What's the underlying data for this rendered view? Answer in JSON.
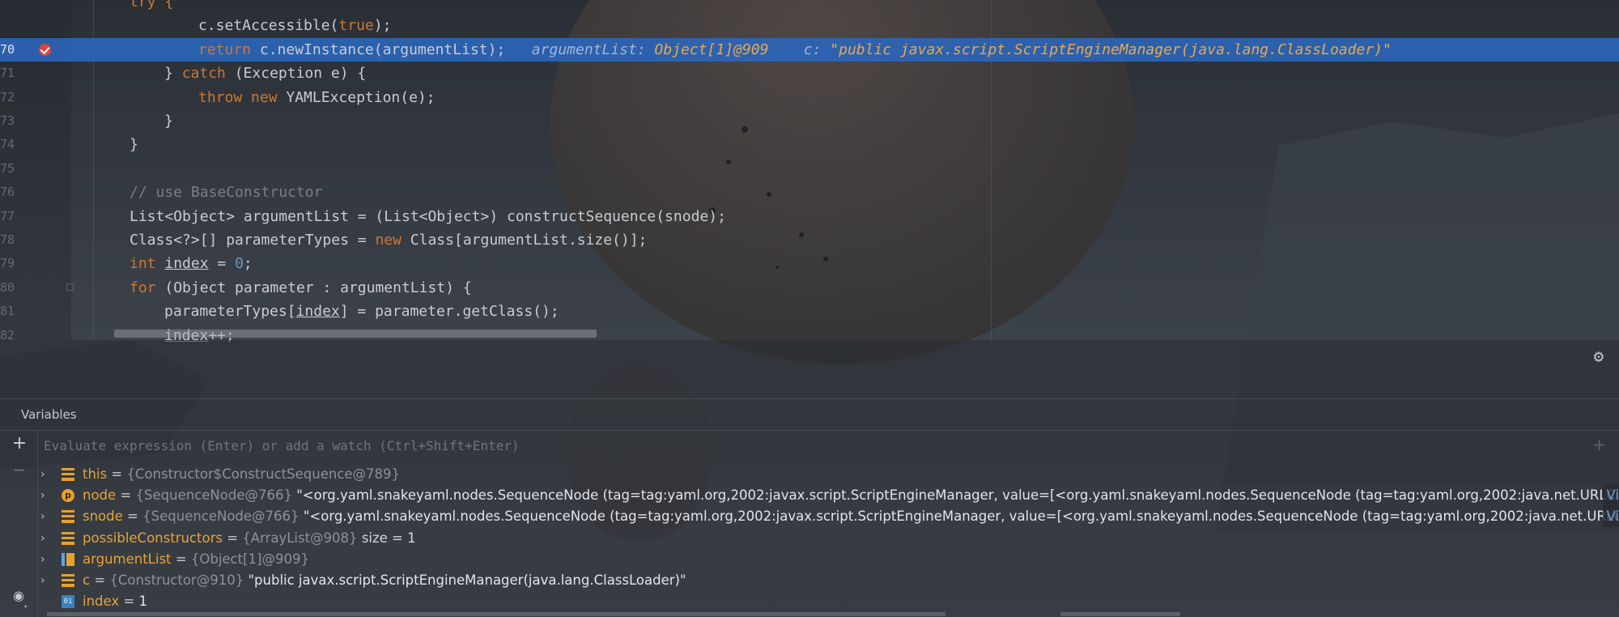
{
  "editor": {
    "lines": [
      {
        "num": "",
        "tokens": [
          {
            "t": "try {",
            "c": "kw"
          }
        ],
        "indent": 160
      },
      {
        "num": "",
        "tokens": [
          {
            "t": "c.setAccessible(",
            "c": ""
          },
          {
            "t": "true",
            "c": "kw"
          },
          {
            "t": ");",
            "c": ""
          }
        ],
        "indent": 245
      },
      {
        "num": "70",
        "tokens": [
          {
            "t": "return ",
            "c": "kw"
          },
          {
            "t": "c.newInstance(argumentList);",
            "c": ""
          }
        ],
        "indent": 245
      },
      {
        "num": "71",
        "tokens": [
          {
            "t": "} ",
            "c": ""
          },
          {
            "t": "catch ",
            "c": "kw"
          },
          {
            "t": "(Exception e) {",
            "c": ""
          }
        ],
        "indent": 203
      },
      {
        "num": "72",
        "tokens": [
          {
            "t": "throw new ",
            "c": "kw"
          },
          {
            "t": "YAMLException(e);",
            "c": ""
          }
        ],
        "indent": 245
      },
      {
        "num": "73",
        "tokens": [
          {
            "t": "}",
            "c": ""
          }
        ],
        "indent": 203
      },
      {
        "num": "74",
        "tokens": [
          {
            "t": "}",
            "c": ""
          }
        ],
        "indent": 160
      },
      {
        "num": "75",
        "tokens": [],
        "indent": 160
      },
      {
        "num": "76",
        "tokens": [
          {
            "t": "// use BaseConstructor",
            "c": "cm"
          }
        ],
        "indent": 160
      },
      {
        "num": "77",
        "tokens": [
          {
            "t": "List<Object> argumentList = (List<Object>) constructSequence(snode);",
            "c": ""
          }
        ],
        "indent": 160
      },
      {
        "num": "78",
        "tokens": [
          {
            "t": "Class<?>[] parameterTypes = ",
            "c": ""
          },
          {
            "t": "new ",
            "c": "kw"
          },
          {
            "t": "Class[argumentList.size()];",
            "c": ""
          }
        ],
        "indent": 160
      },
      {
        "num": "79",
        "tokens": [
          {
            "t": "int ",
            "c": "kw"
          },
          {
            "t": "index",
            "c": "ul"
          },
          {
            "t": " = ",
            "c": ""
          },
          {
            "t": "0",
            "c": "num"
          },
          {
            "t": ";",
            "c": ""
          }
        ],
        "indent": 160
      },
      {
        "num": "80",
        "tokens": [
          {
            "t": "for ",
            "c": "kw"
          },
          {
            "t": "(Object parameter : argumentList) {",
            "c": ""
          }
        ],
        "indent": 160
      },
      {
        "num": "81",
        "tokens": [
          {
            "t": "parameterTypes[",
            "c": ""
          },
          {
            "t": "index",
            "c": "ul"
          },
          {
            "t": "] = parameter.getClass();",
            "c": ""
          }
        ],
        "indent": 203
      },
      {
        "num": "82",
        "tokens": [
          {
            "t": "index",
            "c": "ul"
          },
          {
            "t": "++;",
            "c": ""
          }
        ],
        "indent": 203
      }
    ],
    "inline_hint": {
      "label1": "argumentList:",
      "value1": "Object[1]@909",
      "label2": "c:",
      "value2": "\"public javax.script.ScriptEngineManager(java.lang.ClassLoader)\""
    }
  },
  "debug": {
    "panel_title": "Variables",
    "watch_placeholder": "Evaluate expression (Enter) or add a watch (Ctrl+Shift+Enter)",
    "variables": [
      {
        "icon": "field",
        "name": "this",
        "type": "{Constructor$ConstructSequence@789}",
        "value": "",
        "extra": "",
        "expandable": true
      },
      {
        "icon": "param",
        "name": "node",
        "type": "{SequenceNode@766}",
        "value": "\"<org.yaml.snakeyaml.nodes.SequenceNode (tag=tag:yaml.org,2002:javax.script.ScriptEngineManager, value=[<org.yaml.snakeyaml.nodes.SequenceNode (tag=tag:yaml.org,2002:java.net.URLClassLoader, value=...",
        "extra": "",
        "more": "Vi",
        "expandable": true
      },
      {
        "icon": "field",
        "name": "snode",
        "type": "{SequenceNode@766}",
        "value": "\"<org.yaml.snakeyaml.nodes.SequenceNode (tag=tag:yaml.org,2002:javax.script.ScriptEngineManager, value=[<org.yaml.snakeyaml.nodes.SequenceNode (tag=tag:yaml.org,2002:java.net.URLClassLoader, value...",
        "extra": "",
        "more": "Vi",
        "expandable": true
      },
      {
        "icon": "field",
        "name": "possibleConstructors",
        "type": "{ArrayList@908}",
        "value": "",
        "extra": "size = 1",
        "expandable": true
      },
      {
        "icon": "array",
        "name": "argumentList",
        "type": "{Object[1]@909}",
        "value": "",
        "extra": "",
        "expandable": true
      },
      {
        "icon": "field",
        "name": "c",
        "type": "{Constructor@910}",
        "value": "\"public javax.script.ScriptEngineManager(java.lang.ClassLoader)\"",
        "extra": "",
        "expandable": true
      },
      {
        "icon": "prim",
        "name": "index",
        "type": "",
        "value": "1",
        "extra": "",
        "expandable": false
      }
    ]
  },
  "colors": {
    "highlight": "#2b67bd",
    "keyword": "#cc7832",
    "var_name": "#e5a33b"
  },
  "icons": {
    "breakpoint": "breakpoint-check-icon",
    "settings": "gear-icon",
    "add": "plus-icon",
    "remove": "minus-icon",
    "watch": "eye-icon"
  }
}
